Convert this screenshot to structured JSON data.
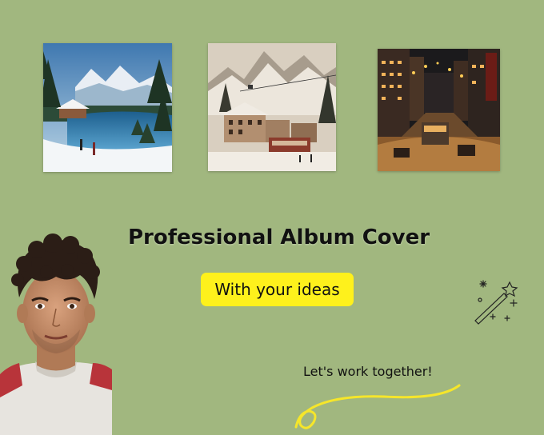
{
  "images": [
    {
      "name": "winter-lake-village-cover"
    },
    {
      "name": "alpine-tram-town-cover"
    },
    {
      "name": "neon-city-street-cover"
    }
  ],
  "headline": "Professional Album Cover",
  "tagline": "With your ideas",
  "cta": "Let's work together!",
  "portrait": {
    "name": "young-man-portrait"
  },
  "colors": {
    "background": "#a1b77f",
    "highlight": "#fef11c",
    "text": "#111111"
  },
  "icons": [
    "magic-wand-icon",
    "sparkle-icon",
    "swoosh-underline"
  ]
}
